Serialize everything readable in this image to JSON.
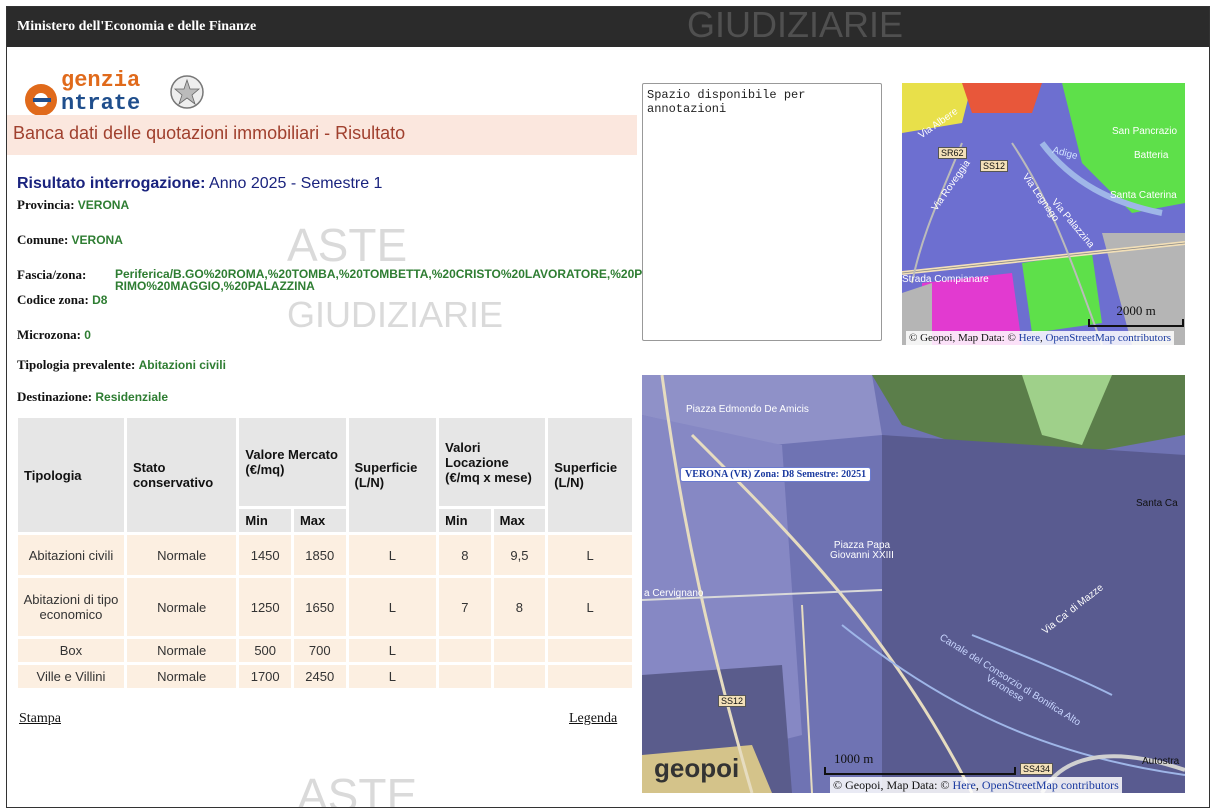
{
  "header": {
    "title": "Ministero dell'Economia e delle Finanze"
  },
  "logo": {
    "line1": "genzia",
    "line2": "ntrate"
  },
  "page": {
    "title": "Banca dati delle quotazioni immobiliari - Risultato"
  },
  "result": {
    "title_label": "Risultato interrogazione:",
    "title_value": "Anno 2025 - Semestre 1",
    "provincia_label": "Provincia:",
    "provincia": "VERONA",
    "comune_label": "Comune:",
    "comune": "VERONA",
    "fascia_label": "Fascia/zona:",
    "fascia": "Periferica/B.GO%20ROMA,%20TOMBA,%20TOMBETTA,%20CRISTO%20LAVORATORE,%20PRIMO%20MAGGIO,%20PALAZZINA",
    "codice_label": "Codice zona:",
    "codice": "D8",
    "microzona_label": "Microzona:",
    "microzona": "0",
    "tipologia_label": "Tipologia prevalente:",
    "tipologia": "Abitazioni civili",
    "destinazione_label": "Destinazione:",
    "destinazione": "Residenziale"
  },
  "table": {
    "headers": {
      "tipologia": "Tipologia",
      "stato": "Stato conservativo",
      "valore": "Valore Mercato (€/mq)",
      "superficie": "Superficie (L/N)",
      "locazione": "Valori Locazione (€/mq x mese)",
      "superficie2": "Superficie (L/N)",
      "min": "Min",
      "max": "Max"
    },
    "rows": [
      {
        "tipologia": "Abitazioni civili",
        "stato": "Normale",
        "vmin": "1450",
        "vmax": "1850",
        "sup": "L",
        "lmin": "8",
        "lmax": "9,5",
        "sup2": "L"
      },
      {
        "tipologia": "Abitazioni di tipo economico",
        "stato": "Normale",
        "vmin": "1250",
        "vmax": "1650",
        "sup": "L",
        "lmin": "7",
        "lmax": "8",
        "sup2": "L"
      },
      {
        "tipologia": "Box",
        "stato": "Normale",
        "vmin": "500",
        "vmax": "700",
        "sup": "L",
        "lmin": "",
        "lmax": "",
        "sup2": ""
      },
      {
        "tipologia": "Ville e Villini",
        "stato": "Normale",
        "vmin": "1700",
        "vmax": "2450",
        "sup": "L",
        "lmin": "",
        "lmax": "",
        "sup2": ""
      }
    ]
  },
  "links": {
    "stampa": "Stampa",
    "legenda": "Legenda"
  },
  "notes": {
    "value": "Spazio disponibile per annotazioni"
  },
  "map_small": {
    "scale": "2000 m",
    "attribution_prefix": "© Geopoi, Map Data: © ",
    "attribution_here": "Here",
    "attribution_osm": "OpenStreetMap contributors",
    "labels": {
      "san_pancrazio": "San Pancrazio",
      "batteria": "Batteria",
      "santa_caterina": "Santa Caterina",
      "strada": "Strada Compianare",
      "via_albere": "Via Albere",
      "via_roveggia": "Via Roveggia",
      "via_legnago": "Via Legnago",
      "via_palazzina": "Via Palazzina",
      "sr62": "SR62",
      "ss12": "SS12",
      "adige": "Adige"
    }
  },
  "map_large": {
    "zone_label": "VERONA (VR) Zona: D8 Semestre: 20251",
    "scale": "1000 m",
    "attribution_prefix": "© Geopoi, Map Data: © ",
    "attribution_here": "Here",
    "attribution_osm": "OpenStreetMap contributors",
    "brand": "geopoi",
    "labels": {
      "piazza_edmondo": "Piazza Edmondo De Amicis",
      "piazza_papa": "Piazza Papa Giovanni XXIII",
      "cervignano": "a Cervignano",
      "santa_ca": "Santa Ca",
      "via_ca_mazze": "Via Ca' di Mazze",
      "canale": "Canale del Consorzio di Bonifica Alto Veronese",
      "autostrada": "Autostra",
      "ss12": "SS12",
      "ss434": "SS434"
    }
  },
  "watermark": {
    "line1": "ASTE",
    "line2": "GIUDIZIARIE"
  }
}
